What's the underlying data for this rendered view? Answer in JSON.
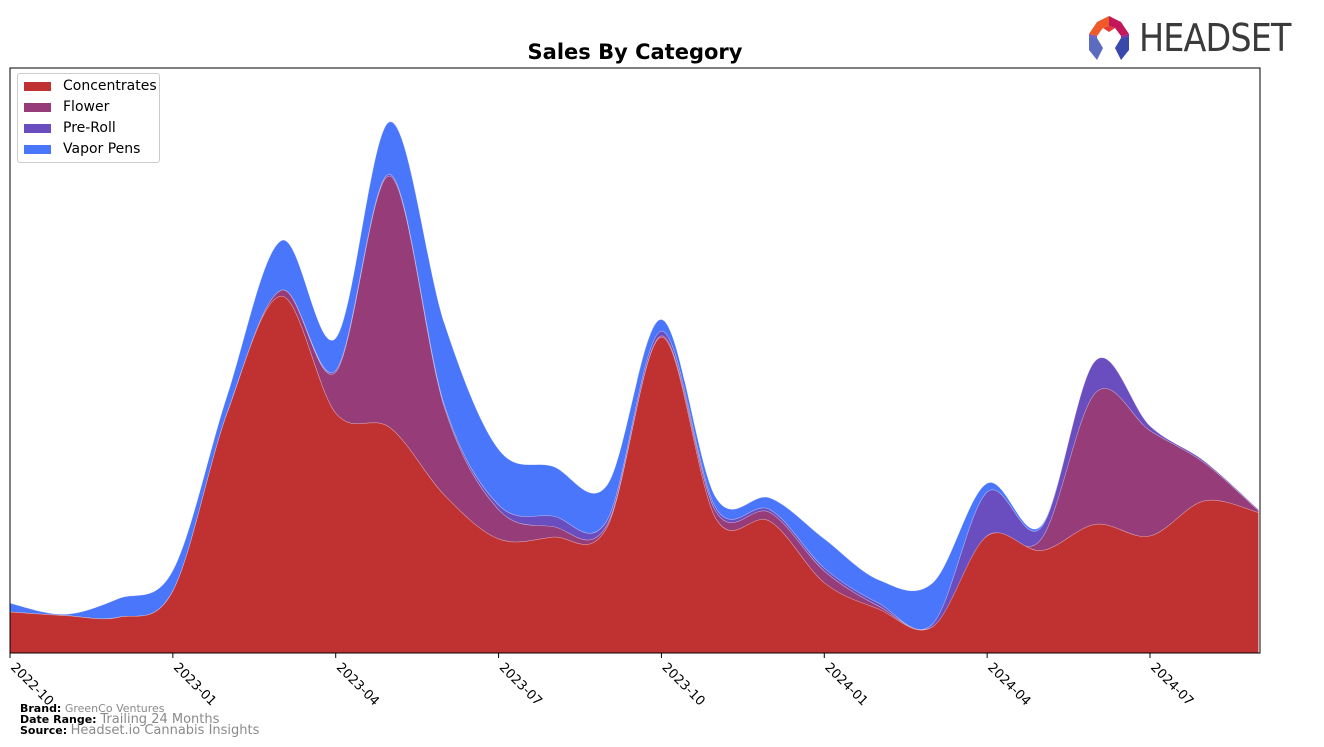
{
  "header": {
    "logo_text": "HEADSET"
  },
  "chart_data": {
    "type": "area",
    "stacked": true,
    "smooth": true,
    "title": "Sales By Category",
    "xlabel": "",
    "ylabel": "",
    "y_ticks_visible": false,
    "grid": false,
    "legend_position": "top-left",
    "x_tick_labels": [
      "2022-10",
      "2023-01",
      "2023-04",
      "2023-07",
      "2023-10",
      "2024-01",
      "2024-04",
      "2024-07"
    ],
    "x": [
      "2022-10",
      "2022-11",
      "2022-12",
      "2023-01",
      "2023-02",
      "2023-03",
      "2023-04",
      "2023-05",
      "2023-06",
      "2023-07",
      "2023-08",
      "2023-09",
      "2023-10",
      "2023-11",
      "2023-12",
      "2024-01",
      "2024-02",
      "2024-03",
      "2024-04",
      "2024-05",
      "2024-06",
      "2024-07",
      "2024-08",
      "2024-09"
    ],
    "ylim": [
      0,
      100
    ],
    "series": [
      {
        "name": "Concentrates",
        "color": "#c03232",
        "values": [
          7.0,
          6.4,
          6.1,
          10.6,
          41.0,
          61.0,
          41.0,
          38.5,
          27.0,
          19.5,
          19.8,
          21.5,
          54.0,
          23.0,
          22.5,
          12.0,
          7.5,
          4.5,
          20.0,
          17.5,
          22.0,
          20.0,
          26.0,
          24.0
        ]
      },
      {
        "name": "Flower",
        "color": "#963c78",
        "values": [
          0.0,
          0.0,
          0.0,
          0.0,
          0.0,
          1.0,
          7.0,
          43.0,
          15.0,
          5.0,
          1.8,
          0.4,
          0.2,
          1.2,
          1.5,
          2.0,
          0.5,
          0.0,
          0.0,
          2.0,
          22.5,
          18.0,
          6.5,
          0.3
        ]
      },
      {
        "name": "Pre-Roll",
        "color": "#6a4ec0",
        "values": [
          0.0,
          0.0,
          0.0,
          0.0,
          0.0,
          0.0,
          0.3,
          0.3,
          0.4,
          0.8,
          1.8,
          0.8,
          0.8,
          0.6,
          0.5,
          0.5,
          0.5,
          0.5,
          7.5,
          2.0,
          5.5,
          0.8,
          0.3,
          0.2
        ]
      },
      {
        "name": "Vapor Pens",
        "color": "#4a76fc",
        "values": [
          1.5,
          0.2,
          3.2,
          3.5,
          3.0,
          8.5,
          5.5,
          9.0,
          14.0,
          9.5,
          8.5,
          6.0,
          2.0,
          1.8,
          2.0,
          5.0,
          4.0,
          7.0,
          1.5,
          0.3,
          0.0,
          0.0,
          0.0,
          0.0
        ]
      }
    ]
  },
  "legend": {
    "items": [
      {
        "label": "Concentrates",
        "color": "#c03232"
      },
      {
        "label": "Flower",
        "color": "#963c78"
      },
      {
        "label": "Pre-Roll",
        "color": "#6a4ec0"
      },
      {
        "label": "Vapor Pens",
        "color": "#4a76fc"
      }
    ]
  },
  "footer": {
    "brand_label": "Brand:",
    "brand_value": "GreenCo Ventures",
    "date_range_label": "Date Range:",
    "date_range_value": "Trailing 24 Months",
    "source_label": "Source:",
    "source_value": "Headset.io Cannabis Insights"
  }
}
